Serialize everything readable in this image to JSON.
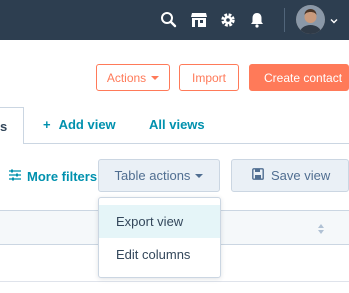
{
  "topbar": {
    "icons": [
      "search-icon",
      "marketplace-icon",
      "gear-icon",
      "bell-icon"
    ],
    "background": "#2d3e50"
  },
  "header_actions": {
    "actions_label": "Actions",
    "import_label": "Import",
    "create_label": "Create contact",
    "accent": "#ff7a59"
  },
  "view_tabs": {
    "current_tab_fragment": "s",
    "add_view_label": "Add view",
    "all_views_label": "All views",
    "link_color": "#0091ae"
  },
  "filters": {
    "more_filters_label": "More filters",
    "table_actions_label": "Table actions",
    "save_view_label": "Save view"
  },
  "table_actions_menu": {
    "items": [
      {
        "label": "Export view",
        "highlighted": true
      },
      {
        "label": "Edit columns",
        "highlighted": false
      }
    ]
  }
}
